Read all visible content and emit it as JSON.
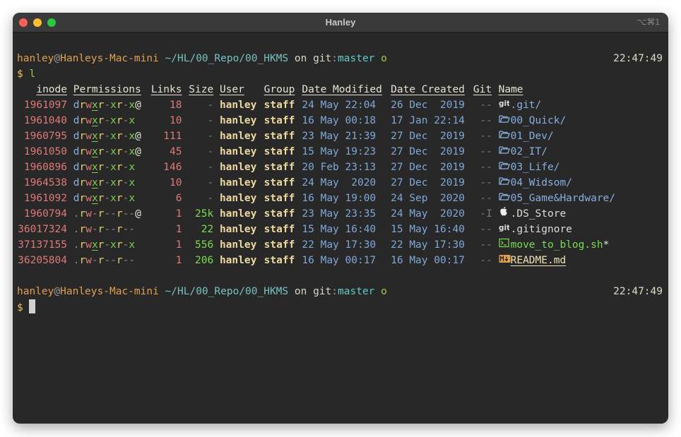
{
  "window": {
    "title": "Hanley",
    "shortcut": "⌥⌘1"
  },
  "prompt": {
    "user": "hanley",
    "host": "Hanleys-Mac-mini",
    "path": "~/HL/00_Repo/00_HKMS",
    "on_text": "on",
    "git_label": "git",
    "branch": "master",
    "status": "o",
    "symbol": "$"
  },
  "first_prompt": {
    "time": "22:47:49",
    "command": "l"
  },
  "second_prompt": {
    "time": "22:47:49"
  },
  "listing": {
    "headers": {
      "inode": "inode",
      "perms": "Permissions",
      "links": "Links",
      "size": "Size",
      "user": "User",
      "group": "Group",
      "modified": "Date Modified",
      "created": "Date Created",
      "git": "Git",
      "name": "Name"
    },
    "rows": [
      {
        "inode": "1961097",
        "perms": "drwxr-xr-x@",
        "links": "18",
        "size": "-",
        "user": "hanley",
        "group": "staff",
        "modified": "24 May 22:04",
        "created": "26 Dec  2019",
        "git": "--",
        "icon": "git",
        "name": ".git",
        "suffix": "/",
        "kind": "dir"
      },
      {
        "inode": "1961040",
        "perms": "drwxr-xr-x",
        "links": "10",
        "size": "-",
        "user": "hanley",
        "group": "staff",
        "modified": "16 May 00:18",
        "created": "17 Jan 22:14",
        "git": "--",
        "icon": "folder",
        "name": "00_Quick",
        "suffix": "/",
        "kind": "dir"
      },
      {
        "inode": "1960795",
        "perms": "drwxr-xr-x@",
        "links": "111",
        "size": "-",
        "user": "hanley",
        "group": "staff",
        "modified": "23 May 21:39",
        "created": "27 Dec  2019",
        "git": "--",
        "icon": "folder",
        "name": "01_Dev",
        "suffix": "/",
        "kind": "dir"
      },
      {
        "inode": "1961050",
        "perms": "drwxr-xr-x@",
        "links": "45",
        "size": "-",
        "user": "hanley",
        "group": "staff",
        "modified": "15 May 19:23",
        "created": "27 Dec  2019",
        "git": "--",
        "icon": "folder",
        "name": "02_IT",
        "suffix": "/",
        "kind": "dir"
      },
      {
        "inode": "1960896",
        "perms": "drwxr-xr-x",
        "links": "146",
        "size": "-",
        "user": "hanley",
        "group": "staff",
        "modified": "20 Feb 23:13",
        "created": "27 Dec  2019",
        "git": "--",
        "icon": "folder",
        "name": "03_Life",
        "suffix": "/",
        "kind": "dir"
      },
      {
        "inode": "1964538",
        "perms": "drwxr-xr-x",
        "links": "10",
        "size": "-",
        "user": "hanley",
        "group": "staff",
        "modified": "24 May  2020",
        "created": "27 Dec  2019",
        "git": "--",
        "icon": "folder",
        "name": "04_Widsom",
        "suffix": "/",
        "kind": "dir"
      },
      {
        "inode": "1961092",
        "perms": "drwxr-xr-x",
        "links": "6",
        "size": "-",
        "user": "hanley",
        "group": "staff",
        "modified": "16 May 19:00",
        "created": "24 Sep  2020",
        "git": "--",
        "icon": "folder",
        "name": "05_Game&Hardware",
        "suffix": "/",
        "kind": "dir"
      },
      {
        "inode": "1960794",
        "perms": ".rw-r--r--@",
        "links": "1",
        "size": "25k",
        "user": "hanley",
        "group": "staff",
        "modified": "23 May 23:35",
        "created": "24 May  2020",
        "git": "-I",
        "icon": "apple",
        "name": ".DS_Store",
        "suffix": "",
        "kind": "ds"
      },
      {
        "inode": "36017324",
        "perms": ".rw-r--r--",
        "links": "1",
        "size": "22",
        "user": "hanley",
        "group": "staff",
        "modified": "15 May 16:40",
        "created": "15 May 16:40",
        "git": "--",
        "icon": "git",
        "name": ".gitignore",
        "suffix": "",
        "kind": "file"
      },
      {
        "inode": "37137155",
        "perms": ".rwxr-xr-x",
        "links": "1",
        "size": "556",
        "user": "hanley",
        "group": "staff",
        "modified": "22 May 17:30",
        "created": "22 May 17:30",
        "git": "--",
        "icon": "shell",
        "name": "move_to_blog.sh",
        "suffix": "*",
        "kind": "exec"
      },
      {
        "inode": "36205804",
        "perms": ".rw-r--r--",
        "links": "1",
        "size": "206",
        "user": "hanley",
        "group": "staff",
        "modified": "16 May 00:17",
        "created": "16 May 00:17",
        "git": "--",
        "icon": "markdown",
        "name": "README.md",
        "suffix": "",
        "kind": "readme"
      }
    ]
  },
  "colors": {
    "dir": "#87afdf",
    "exec": "#78dc50",
    "readme": "#ece4b4",
    "file": "#dcdcdc",
    "ds": "#dcdcdc"
  }
}
